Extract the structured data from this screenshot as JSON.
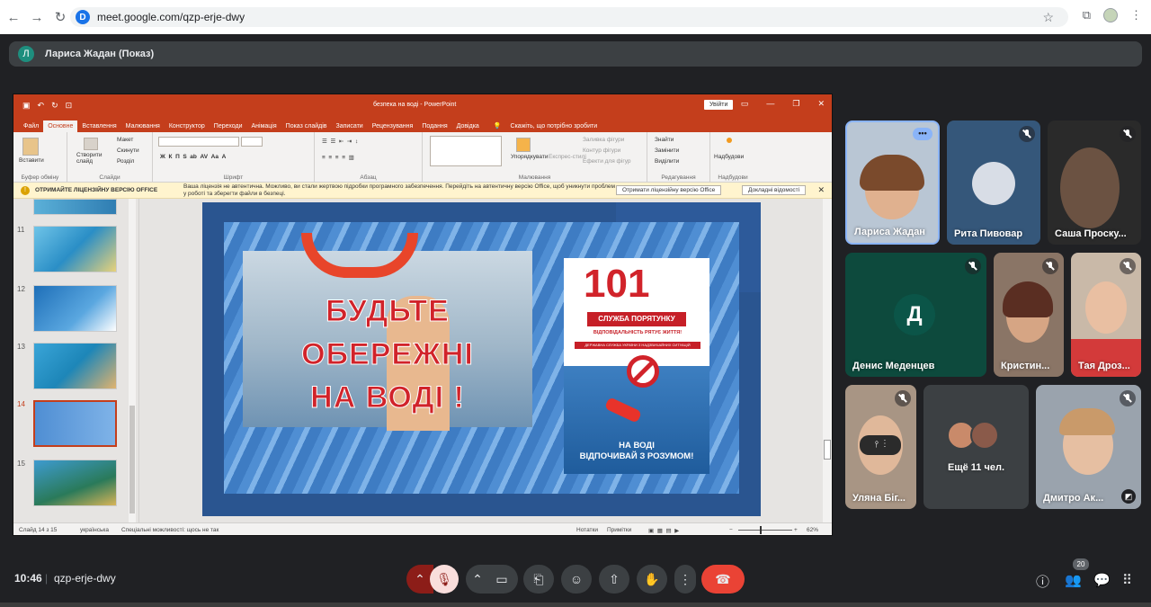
{
  "browser": {
    "url": "meet.google.com/qzp-erje-dwy",
    "site_icon_letter": "D"
  },
  "presenting": {
    "avatar_letter": "Л",
    "label": "Лариса Жадан (Показ)"
  },
  "powerpoint": {
    "doc_title": "безпека на воді  -  PowerPoint",
    "signin": "Увійти",
    "tabs": [
      "Файл",
      "Основне",
      "Вставлення",
      "Малювання",
      "Конструктор",
      "Переходи",
      "Анімація",
      "Показ слайдів",
      "Записати",
      "Рецензування",
      "Подання",
      "Довідка"
    ],
    "tell_me": "Скажіть, що потрібно зробити",
    "ribbon": {
      "paste": "Вставити",
      "clipboard_group": "Буфер обміну",
      "new_slide": "Створити слайд",
      "layout": "Макет",
      "reset": "Скинути",
      "section": "Розділ",
      "slides_group": "Слайди",
      "font_group": "Шрифт",
      "paragraph_group": "Абзац",
      "arrange": "Упорядкувати",
      "quick_styles": "Експрес-стилі",
      "fill": "Заливка фігури",
      "outline": "Контур фігури",
      "effects": "Ефекти для фігур",
      "drawing_group": "Малювання",
      "find": "Знайти",
      "replace": "Замінити",
      "select": "Виділити",
      "editing_group": "Редагування",
      "addins": "Надбудови",
      "addins_group": "Надбудови"
    },
    "license_bar": {
      "title": "ОТРИМАЙТЕ ЛІЦЕНЗІЙНУ ВЕРСІЮ OFFICE",
      "message": "Ваша ліцензія не автентична. Можливо, ви стали жертвою підробки програмного забезпечення. Перейдіть на автентичну версію Office, щоб уникнути проблем у роботі та зберегти файли в безпеці.",
      "get_button": "Отримати ліцензійну версію Office",
      "details_button": "Докладні відомості"
    },
    "thumbnails": [
      "11",
      "12",
      "13",
      "14",
      "15"
    ],
    "slide": {
      "title_line1": "БУДЬТЕ",
      "title_line2": "ОБЕРЕЖНІ",
      "title_line3": "НА ВОДІ !",
      "poster_number": "101",
      "poster_band": "СЛУЖБА ПОРЯТУНКУ",
      "poster_sub": "ВІДПОВІДАЛЬНІСТЬ РЯТУЄ ЖИТТЯ!",
      "poster_sub2": "ДЕРЖАВНА СЛУЖБА УКРАЇНИ З НАДЗВИЧАЙНИХ СИТУАЦІЙ",
      "poster_bottom1": "НА ВОДІ",
      "poster_bottom2": "ВІДПОЧИВАЙ З РОЗУМОМ!"
    },
    "status": {
      "slide_of": "Слайд 14 з 15",
      "language": "українська",
      "accessibility": "Спеціальні можливості: щось не так",
      "notes": "Нотатки",
      "comments": "Примітки",
      "zoom": "62%"
    }
  },
  "participants": [
    {
      "name": "Лариса Жадан"
    },
    {
      "name": "Рита Пивовар"
    },
    {
      "name": "Саша Проску..."
    },
    {
      "name": "Денис Меденцев",
      "avatar_letter": "Д"
    },
    {
      "name": "Кристин..."
    },
    {
      "name": "Тая Дроз..."
    },
    {
      "name": "Уляна Біг..."
    },
    {
      "name": "Ещё 11 чел."
    },
    {
      "name": "Дмитро Ак..."
    }
  ],
  "bottom": {
    "time": "10:46",
    "meeting_code": "qzp-erje-dwy",
    "people_count": "20"
  }
}
